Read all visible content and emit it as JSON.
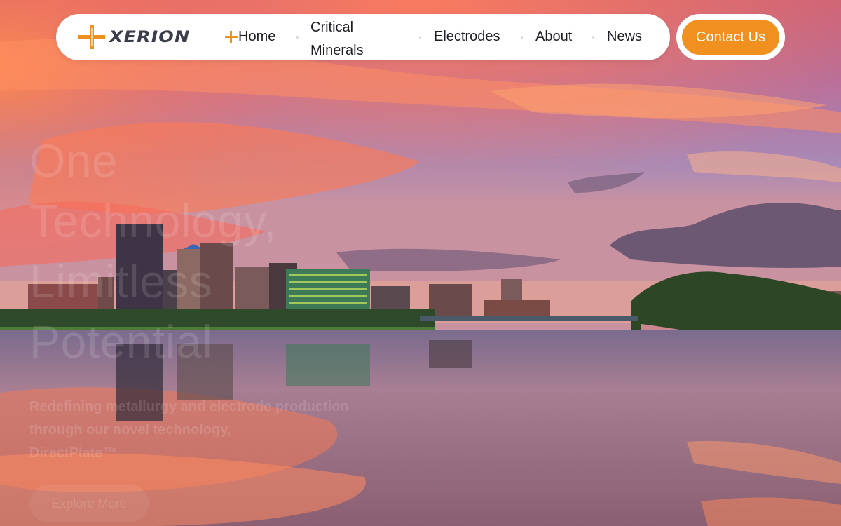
{
  "brand": {
    "name": "XERION",
    "accent_color": "#f0901e",
    "logo_icon": "xerion-plus-mark-icon"
  },
  "nav": {
    "items": [
      {
        "label": "Home",
        "icon": "plus-icon"
      },
      {
        "label": "Critical Minerals"
      },
      {
        "label": "Electrodes"
      },
      {
        "label": "About"
      },
      {
        "label": "News"
      }
    ],
    "contact_label": "Contact Us"
  },
  "hero": {
    "title_lines": [
      "One",
      "Technology,",
      "Limitless",
      "Potential"
    ],
    "subtitle": "Redefining metallurgy and electrode production through our novel technology,",
    "tech_name": "DirectPlate™",
    "cta_label": "Explore More"
  },
  "background": {
    "description_icon": "city-skyline-sunset-image"
  }
}
